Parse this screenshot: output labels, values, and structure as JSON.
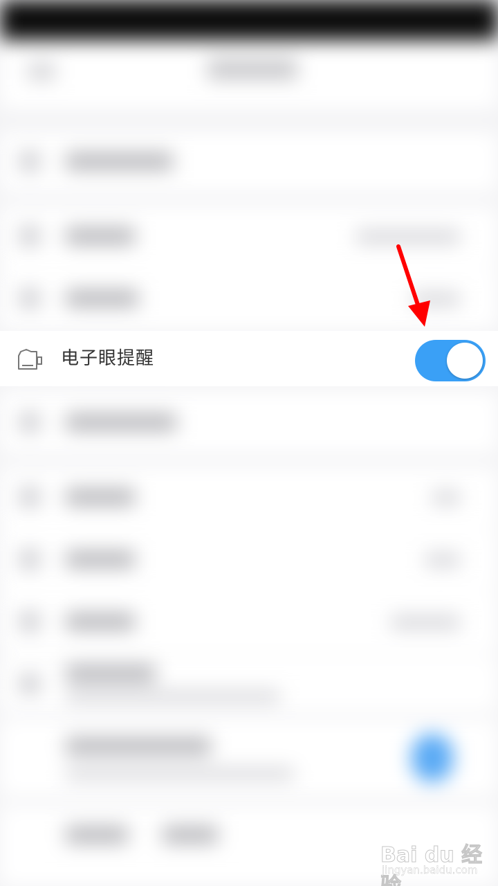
{
  "row": {
    "label": "电子眼提醒",
    "icon": "camera-icon",
    "toggle_on": true,
    "toggle_color": "#3aa0f6"
  },
  "annotation": {
    "type": "arrow",
    "color": "#ff0000"
  },
  "watermark": {
    "brand": "Bai du 经验",
    "url": "jingyan.baidu.com"
  }
}
